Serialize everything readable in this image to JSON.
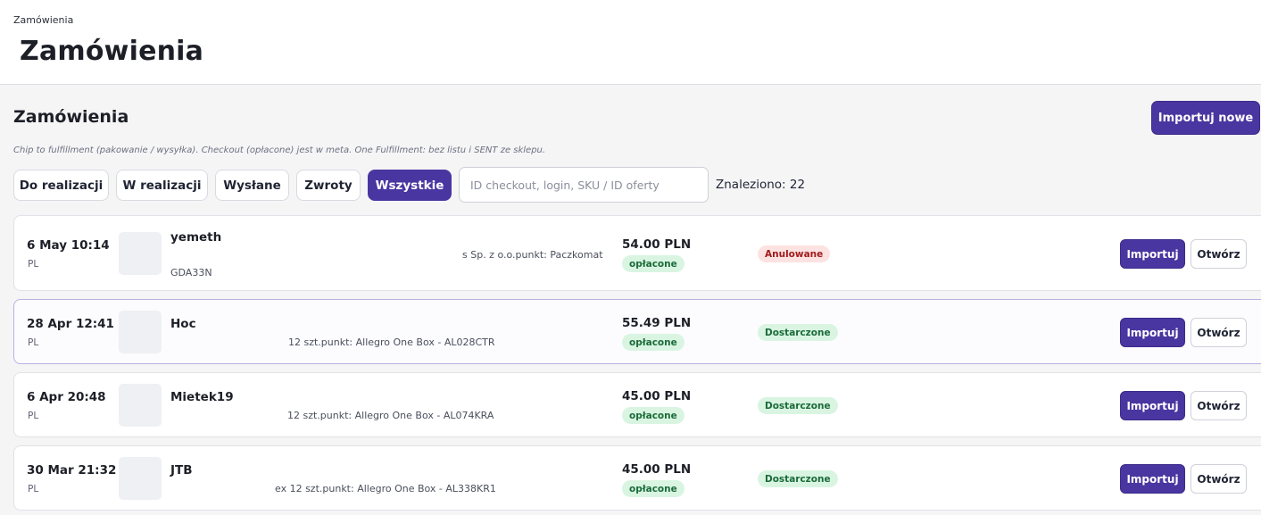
{
  "header": {
    "breadcrumb": "Zamówienia",
    "title": "Zamówienia"
  },
  "section": {
    "title": "Zamówienia",
    "import_new_label": "Importuj nowe",
    "hint": "Chip to fulfillment (pakowanie / wysyłka). Checkout (opłacone) jest w meta. One Fulfillment: bez listu i SENT ze sklepu."
  },
  "filters": {
    "chips": [
      "Do realizacji",
      "W realizacji",
      "Wysłane",
      "Zwroty",
      "Wszystkie"
    ],
    "active": "Wszystkie"
  },
  "search": {
    "placeholder": "ID checkout, login, SKU / ID oferty",
    "value": ""
  },
  "found_label": "Znaleziono: 22",
  "orders": [
    {
      "date": "6 May 10:14",
      "country": "PL",
      "buyer": "yemeth",
      "delivery": "s Sp. z o.o.punkt: Paczkomat",
      "ref": "GDA33N",
      "amount": "54.00 PLN",
      "payment": "opłacone",
      "status": "Anulowane",
      "status_color": "#fde2e2",
      "import_label": "Importuj",
      "open_label": "Otwórz"
    },
    {
      "date": "28 Apr 12:41",
      "country": "PL",
      "buyer": "Hoc",
      "delivery": "12 szt.punkt: Allegro One Box - AL028CTR",
      "amount": "55.49 PLN",
      "payment": "opłacone",
      "status": "Dostarczone",
      "status_color": "#d9f5e2",
      "import_label": "Importuj",
      "open_label": "Otwórz"
    },
    {
      "date": "6 Apr 20:48",
      "country": "PL",
      "buyer": "Mietek19",
      "delivery": "12 szt.punkt: Allegro One Box - AL074KRA",
      "amount": "45.00 PLN",
      "payment": "opłacone",
      "status": "Dostarczone",
      "status_color": "#d9f5e2",
      "import_label": "Importuj",
      "open_label": "Otwórz"
    },
    {
      "date": "30 Mar 21:32",
      "country": "PL",
      "buyer": "JTB",
      "delivery": "ex 12 szt.punkt: Allegro One Box - AL338KR1",
      "amount": "45.00 PLN",
      "payment": "opłacone",
      "status": "Dostarczone",
      "status_color": "#d9f5e2",
      "import_label": "Importuj",
      "open_label": "Otwórz"
    }
  ],
  "colors": {
    "accent": "#4a36a0",
    "paid_bg": "#d9f5e2",
    "cancelled_bg": "#fde2e2"
  }
}
